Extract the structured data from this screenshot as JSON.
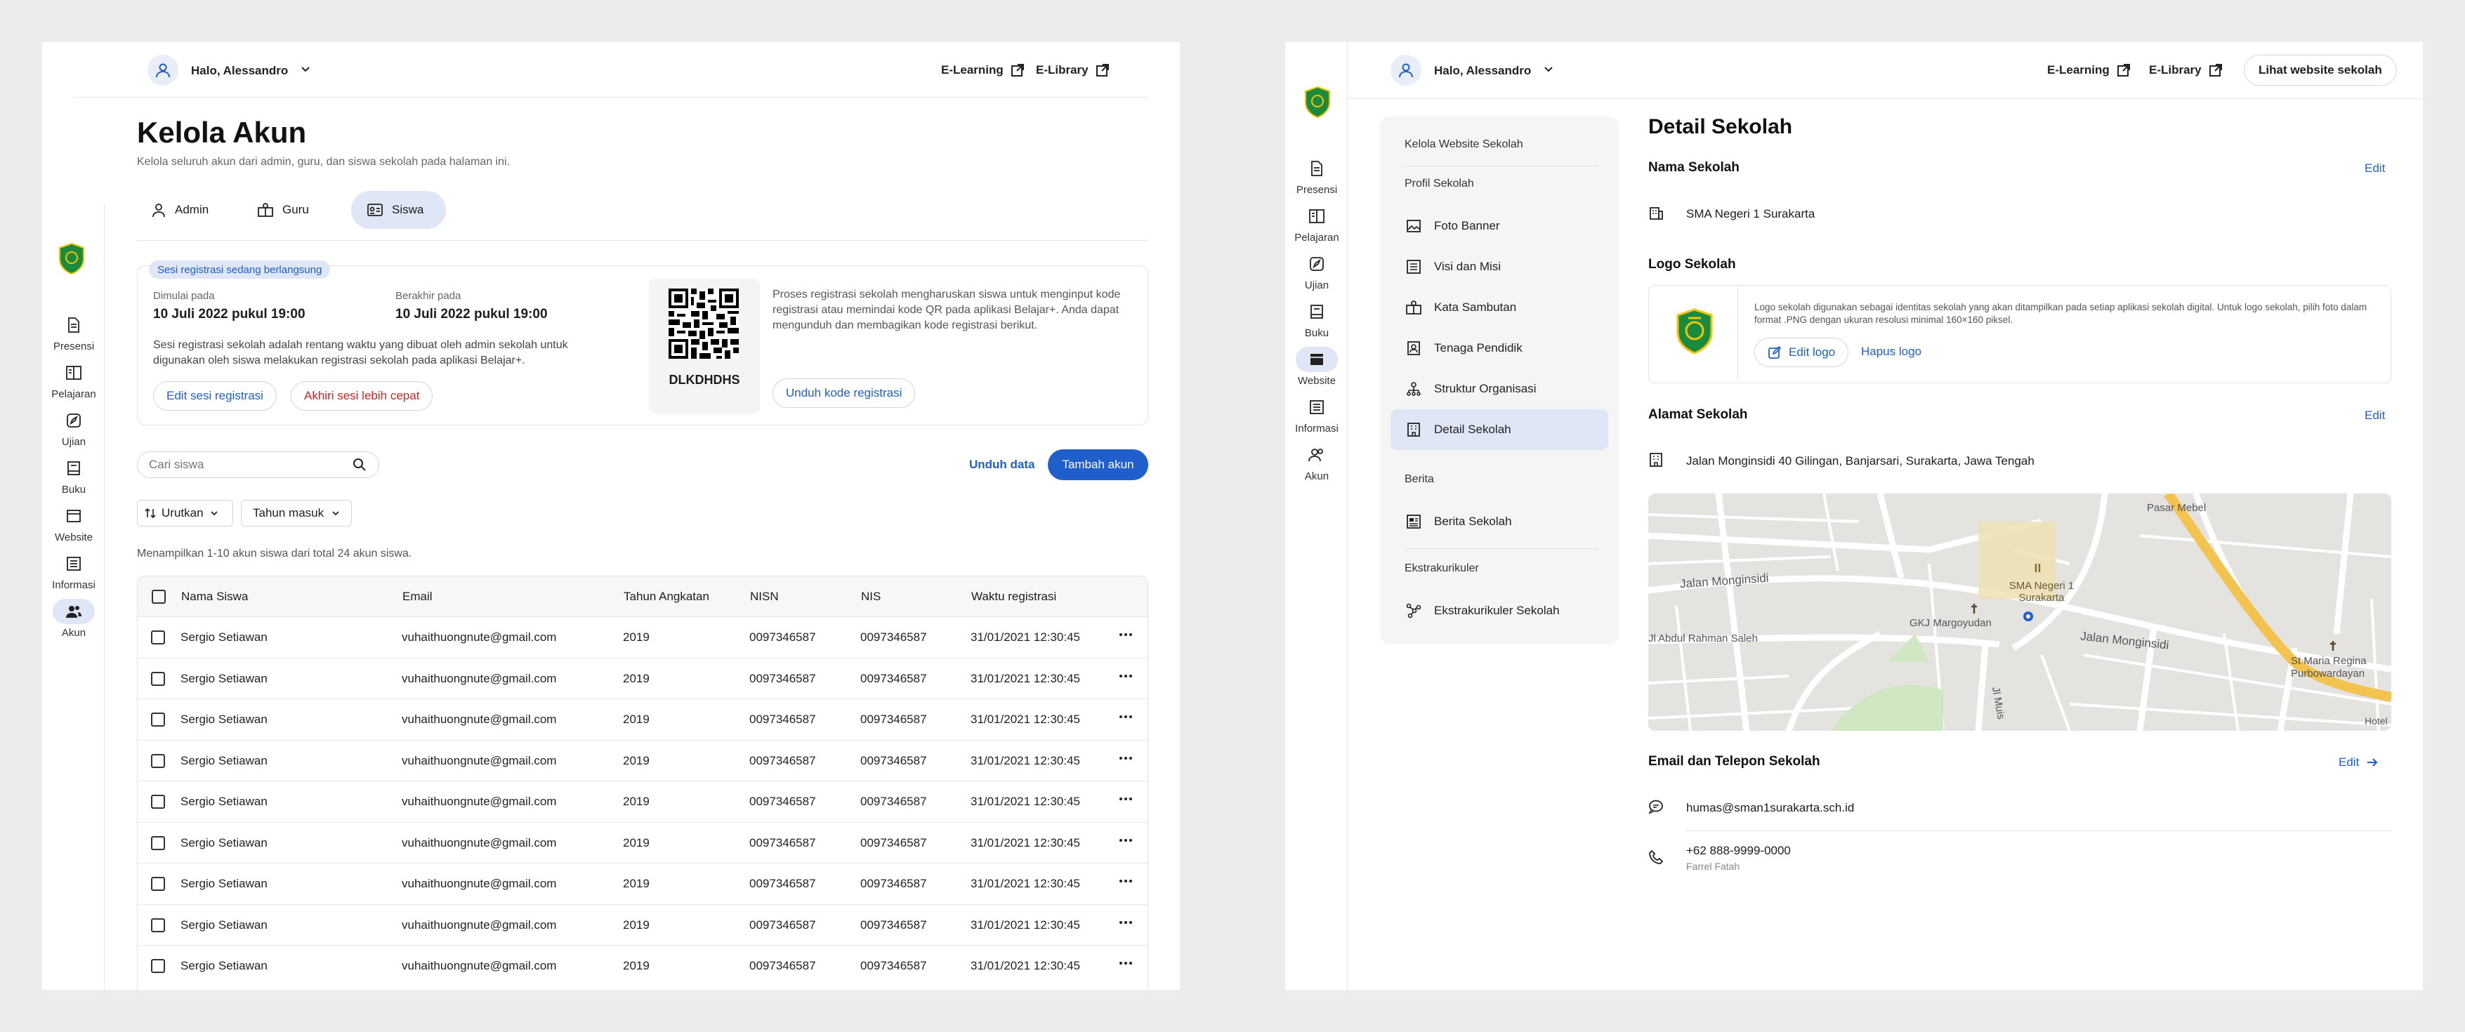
{
  "user": {
    "greeting": "Halo, Alessandro"
  },
  "links": {
    "elearning": "E-Learning",
    "elibrary": "E-Library",
    "website": "Lihat website sekolah"
  },
  "sidebar": {
    "items": [
      {
        "label": "Presensi"
      },
      {
        "label": "Pelajaran"
      },
      {
        "label": "Ujian"
      },
      {
        "label": "Buku"
      },
      {
        "label": "Website"
      },
      {
        "label": "Informasi"
      },
      {
        "label": "Akun"
      }
    ]
  },
  "kelola": {
    "title": "Kelola Akun",
    "subtitle": "Kelola seluruh akun dari admin, guru, dan siswa sekolah pada halaman ini.",
    "tabs": [
      "Admin",
      "Guru",
      "Siswa"
    ],
    "session": {
      "badge": "Sesi registrasi sedang berlangsung",
      "start_label": "Dimulai pada",
      "start_value": "10 Juli 2022 pukul 19:00",
      "end_label": "Berakhir pada",
      "end_value": "10 Juli 2022 pukul 19:00",
      "desc": "Sesi registrasi sekolah adalah rentang waktu yang dibuat oleh admin sekolah untuk digunakan oleh siswa melakukan registrasi sekolah pada aplikasi Belajar+.",
      "edit_btn": "Edit sesi registrasi",
      "end_btn": "Akhiri sesi lebih cepat",
      "qr_code": "DLKDHDHS",
      "qr_desc": "Proses registrasi sekolah mengharuskan siswa untuk menginput kode registrasi atau memindai kode QR pada aplikasi Belajar+. Anda dapat mengunduh dan membagikan kode registrasi berikut.",
      "download_btn": "Unduh kode registrasi"
    },
    "search_placeholder": "Cari siswa",
    "unduh_data": "Unduh data",
    "tambah_akun": "Tambah akun",
    "filters": [
      "Urutkan",
      "Tahun masuk"
    ],
    "showing": "Menampilkan 1-10 akun siswa dari total 24 akun siswa.",
    "columns": [
      "Nama Siswa",
      "Email",
      "Tahun Angkatan",
      "NISN",
      "NIS",
      "Waktu registrasi"
    ],
    "rows": [
      {
        "name": "Sergio Setiawan",
        "email": "vuhaithuongnute@gmail.com",
        "year": "2019",
        "nisn": "0097346587",
        "nis": "0097346587",
        "time": "31/01/2021 12:30:45"
      },
      {
        "name": "Sergio Setiawan",
        "email": "vuhaithuongnute@gmail.com",
        "year": "2019",
        "nisn": "0097346587",
        "nis": "0097346587",
        "time": "31/01/2021 12:30:45"
      },
      {
        "name": "Sergio Setiawan",
        "email": "vuhaithuongnute@gmail.com",
        "year": "2019",
        "nisn": "0097346587",
        "nis": "0097346587",
        "time": "31/01/2021 12:30:45"
      },
      {
        "name": "Sergio Setiawan",
        "email": "vuhaithuongnute@gmail.com",
        "year": "2019",
        "nisn": "0097346587",
        "nis": "0097346587",
        "time": "31/01/2021 12:30:45"
      },
      {
        "name": "Sergio Setiawan",
        "email": "vuhaithuongnute@gmail.com",
        "year": "2019",
        "nisn": "0097346587",
        "nis": "0097346587",
        "time": "31/01/2021 12:30:45"
      },
      {
        "name": "Sergio Setiawan",
        "email": "vuhaithuongnute@gmail.com",
        "year": "2019",
        "nisn": "0097346587",
        "nis": "0097346587",
        "time": "31/01/2021 12:30:45"
      },
      {
        "name": "Sergio Setiawan",
        "email": "vuhaithuongnute@gmail.com",
        "year": "2019",
        "nisn": "0097346587",
        "nis": "0097346587",
        "time": "31/01/2021 12:30:45"
      },
      {
        "name": "Sergio Setiawan",
        "email": "vuhaithuongnute@gmail.com",
        "year": "2019",
        "nisn": "0097346587",
        "nis": "0097346587",
        "time": "31/01/2021 12:30:45"
      },
      {
        "name": "Sergio Setiawan",
        "email": "vuhaithuongnute@gmail.com",
        "year": "2019",
        "nisn": "0097346587",
        "nis": "0097346587",
        "time": "31/01/2021 12:30:45"
      }
    ]
  },
  "website": {
    "menu_groups": {
      "kelola": "Kelola Website Sekolah",
      "profil": "Profil Sekolah",
      "berita": "Berita",
      "ekstra": "Ekstrakurikuler"
    },
    "menu_items": [
      "Foto Banner",
      "Visi dan Misi",
      "Kata Sambutan",
      "Tenaga Pendidik",
      "Struktur Organisasi",
      "Detail Sekolah",
      "Berita Sekolah",
      "Ekstrakurikuler Sekolah"
    ],
    "title": "Detail Sekolah",
    "nama_label": "Nama Sekolah",
    "nama_value": "SMA Negeri 1 Surakarta",
    "logo_label": "Logo Sekolah",
    "logo_desc": "Logo sekolah digunakan sebagai identitas sekolah yang akan ditampilkan pada setiap aplikasi sekolah digital. Untuk logo sekolah, pilih foto dalam format .PNG dengan ukuran resolusi minimal 160×160 piksel.",
    "edit_logo": "Edit logo",
    "hapus_logo": "Hapus logo",
    "alamat_label": "Alamat Sekolah",
    "alamat_value": "Jalan Monginsidi 40 Gilingan, Banjarsari, Surakarta, Jawa Tengah",
    "map_labels": {
      "school": "SMA Negeri 1 Surakarta",
      "street1": "Jalan Monginsidi",
      "street2": "Jalan Monginsidi",
      "street3": "Jl Abdul Rahman Saleh",
      "place1": "GKJ Margoyudan",
      "place2": "Pasar Mebel",
      "place3": "St Maria Regina Purbowardayan",
      "place4": "Hotel",
      "street4": "Jl Muis"
    },
    "kontak_label": "Email dan Telepon Sekolah",
    "email": "humas@sman1surakarta.sch.id",
    "phone": "+62 888-9999-0000",
    "phone_owner": "Farrel Fatah",
    "edit": "Edit"
  },
  "colors": {
    "accent": "#1f5fcc",
    "logo_green": "#1c8a3c",
    "logo_yellow": "#f2c400"
  }
}
